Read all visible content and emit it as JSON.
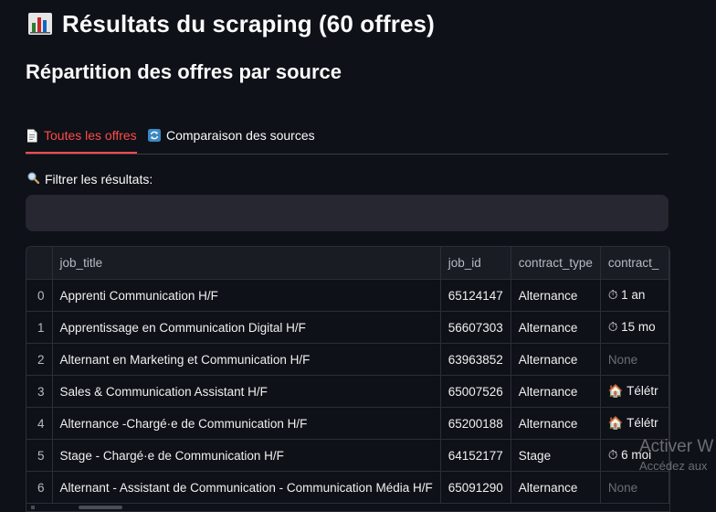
{
  "header": {
    "title": "Résultats du scraping (60 offres)",
    "subtitle": "Répartition des offres par source"
  },
  "tabs": [
    {
      "label": "Toutes les offres",
      "icon": "document-icon",
      "active": true
    },
    {
      "label": "Comparaison des sources",
      "icon": "refresh-icon",
      "active": false
    }
  ],
  "filter": {
    "label": "Filtrer les résultats:",
    "icon": "magnifier-icon",
    "value": "",
    "placeholder": ""
  },
  "table": {
    "columns": [
      "",
      "job_title",
      "job_id",
      "contract_type",
      "contract_"
    ],
    "rows": [
      {
        "index": "0",
        "job_title": "Apprenti Communication H/F",
        "job_id": "65124147",
        "contract_type": "Alternance",
        "contract_extra": "⏱ 1 an"
      },
      {
        "index": "1",
        "job_title": "Apprentissage en Communication Digital H/F",
        "job_id": "56607303",
        "contract_type": "Alternance",
        "contract_extra": "⏱ 15 mo"
      },
      {
        "index": "2",
        "job_title": "Alternant en Marketing et Communication H/F",
        "job_id": "63963852",
        "contract_type": "Alternance",
        "contract_extra": "None"
      },
      {
        "index": "3",
        "job_title": "Sales & Communication Assistant H/F",
        "job_id": "65007526",
        "contract_type": "Alternance",
        "contract_extra": "🏠 Télétr"
      },
      {
        "index": "4",
        "job_title": "Alternance -Chargé·e de Communication H/F",
        "job_id": "65200188",
        "contract_type": "Alternance",
        "contract_extra": "🏠 Télétr"
      },
      {
        "index": "5",
        "job_title": "Stage - Chargé·e de Communication H/F",
        "job_id": "64152177",
        "contract_type": "Stage",
        "contract_extra": "⏱ 6 moi"
      },
      {
        "index": "6",
        "job_title": "Alternant - Assistant de Communication - Communication Média H/F",
        "job_id": "65091290",
        "contract_type": "Alternance",
        "contract_extra": "None"
      }
    ]
  },
  "watermark": {
    "line1": "Activer W",
    "line2": "Accédez aux"
  },
  "colors": {
    "background": "#0e1117",
    "accent": "#ff4b4b",
    "input_bg": "#262730",
    "grid_border": "#2b2e36"
  }
}
